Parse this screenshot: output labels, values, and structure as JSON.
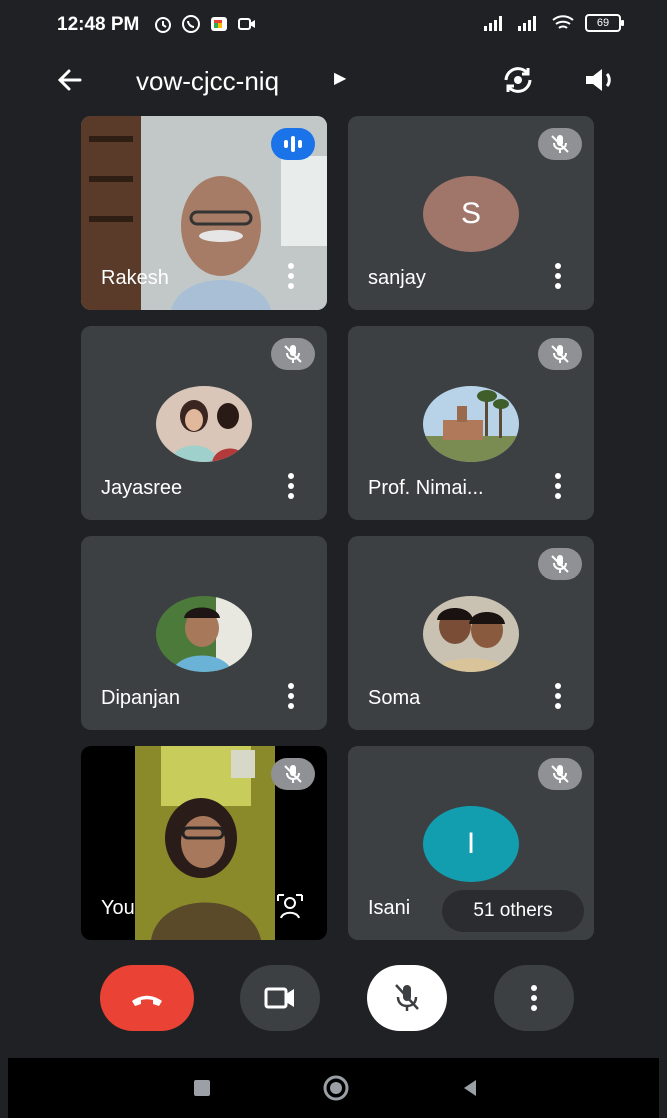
{
  "status_bar": {
    "time": "12:48 PM",
    "battery": "69",
    "icons": [
      "alarm-icon",
      "whatsapp-icon",
      "google-meet-icon",
      "video-status-icon",
      "signal-icon",
      "signal-icon",
      "wifi-icon"
    ]
  },
  "header": {
    "meeting_code": "vow-cjcc-niq",
    "icons": [
      "back-arrow-icon",
      "play-arrow-icon",
      "switch-camera-icon",
      "speaker-icon"
    ]
  },
  "participants": [
    {
      "name": "Rakesh",
      "state": "speaking",
      "media": "video"
    },
    {
      "name": "sanjay",
      "state": "muted",
      "media": "initial",
      "initial": "S",
      "color": "#a0756a"
    },
    {
      "name": "Jayasree",
      "state": "muted",
      "media": "photo"
    },
    {
      "name": "Prof. Nimai...",
      "state": "muted",
      "media": "photo"
    },
    {
      "name": "Dipanjan",
      "state": "unmuted",
      "media": "photo"
    },
    {
      "name": "Soma",
      "state": "muted",
      "media": "photo"
    },
    {
      "name": "You",
      "state": "muted",
      "media": "video"
    },
    {
      "name": "Isani",
      "state": "muted",
      "media": "initial",
      "initial": "I",
      "color": "#129eaf"
    }
  ],
  "others_label": "51 others",
  "colors": {
    "background": "#202124",
    "tile": "#3c4043",
    "end_call": "#ea4335",
    "speaking": "#1a73e8"
  },
  "controls": [
    "end-call-button",
    "camera-button",
    "microphone-button",
    "more-options-button"
  ],
  "nav": [
    "recents-icon",
    "home-icon",
    "back-icon"
  ]
}
